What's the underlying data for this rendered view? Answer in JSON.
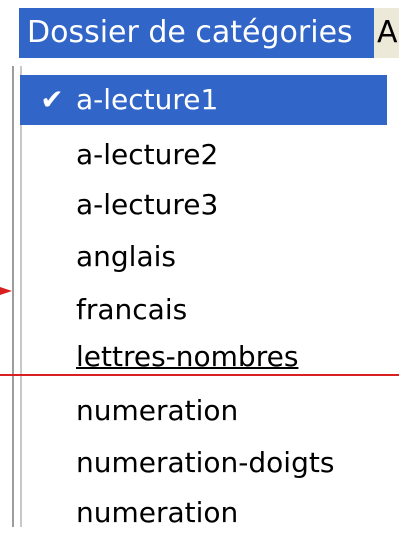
{
  "menubar": {
    "active_menu": "Dossier de catégories",
    "next_menu": "A"
  },
  "dropdown": {
    "items": [
      {
        "label": "a-lecture1",
        "checked": true
      },
      {
        "label": "a-lecture2"
      },
      {
        "label": "a-lecture3"
      },
      {
        "label": "anglais"
      },
      {
        "label": "francais"
      },
      {
        "label": "lettres-nombres"
      },
      {
        "label": "numeration"
      },
      {
        "label": "numeration-doigts"
      },
      {
        "label": "numeration"
      }
    ]
  },
  "colors": {
    "highlight": "#3166c8",
    "annotation": "#d91f1f"
  },
  "icons": {
    "check": "checkmark-icon",
    "arrow": "red-arrow-icon"
  }
}
